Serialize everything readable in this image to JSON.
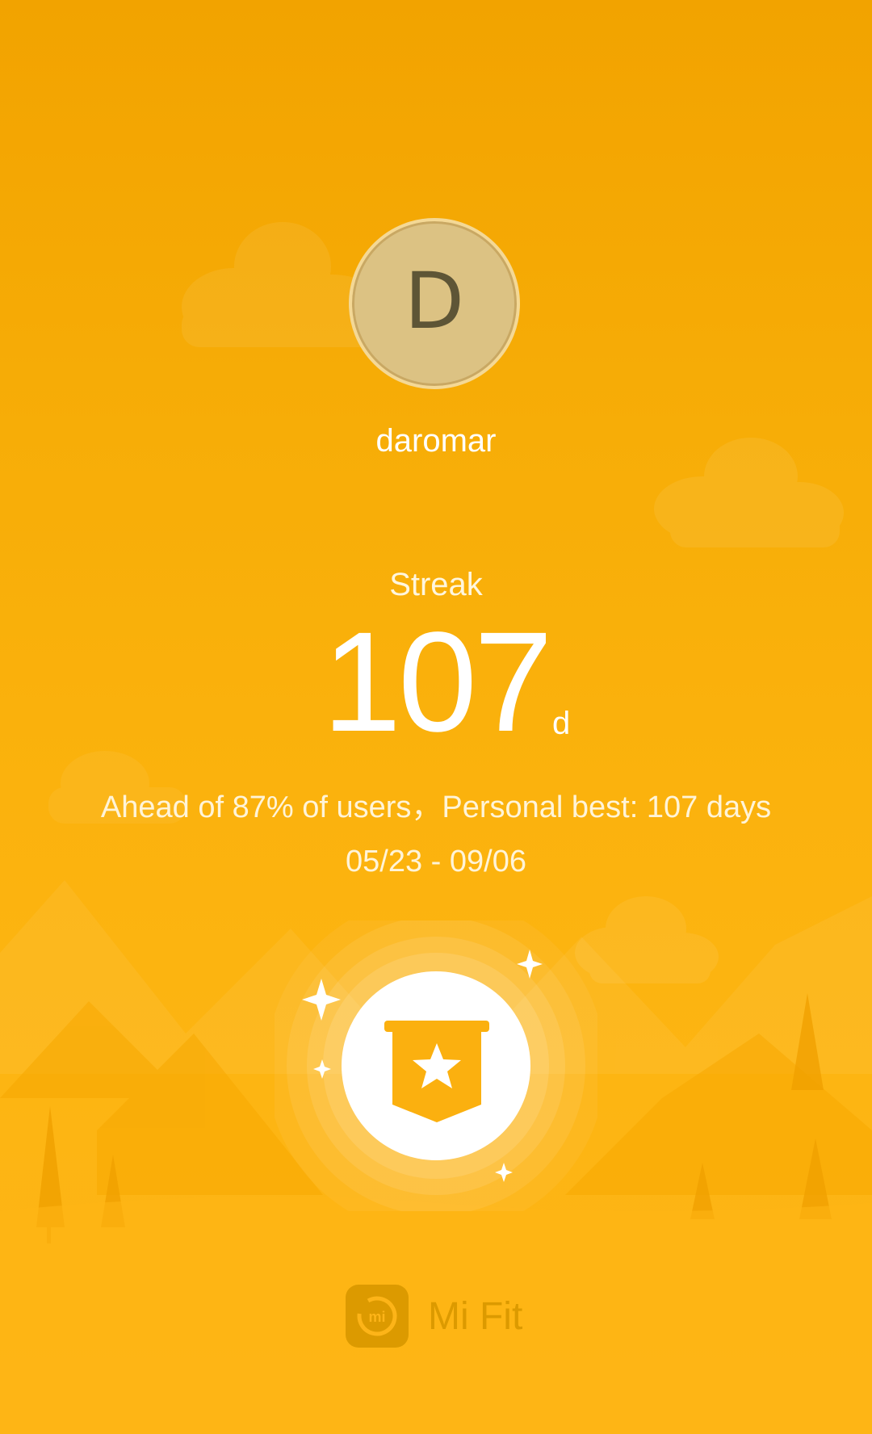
{
  "colors": {
    "background_top": "#f2a300",
    "background_bottom": "#fdb418",
    "avatar_fill": "#dcc283",
    "avatar_letter": "#5e5536",
    "badge_fill": "#ffffff",
    "badge_icon": "#fbb00f",
    "brand": "#dc9a00"
  },
  "profile": {
    "avatar_initial": "D",
    "username": "daromar"
  },
  "streak": {
    "label": "Streak",
    "value": "107",
    "unit": "d",
    "summary": "Ahead of 87% of users，Personal best: 107 days",
    "date_range": "05/23 - 09/06"
  },
  "badge": {
    "icon": "banner-star-icon",
    "sparkles": "sparkle-icon"
  },
  "brand": {
    "logo_icon": "mi-logo-icon",
    "logo_text": "mi",
    "name": "Mi Fit"
  }
}
